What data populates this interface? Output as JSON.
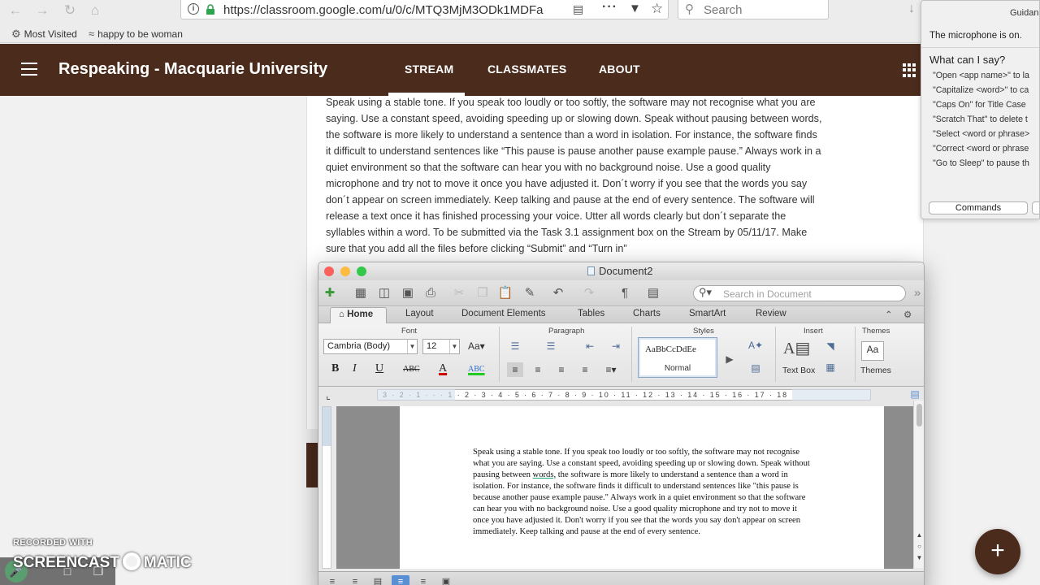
{
  "browser": {
    "url": "https://classroom.google.com/u/0/c/MTQ3MjM3ODk1MDFa",
    "search_placeholder": "Search",
    "bookmarks": [
      "Most Visited",
      "happy to be woman"
    ]
  },
  "classroom": {
    "title": "Respeaking - Macquarie University",
    "tabs": [
      "STREAM",
      "CLASSMATES",
      "ABOUT"
    ],
    "active_tab": "STREAM",
    "stream_text": "Speak using a stable tone. If you speak too loudly or too softly, the software may not recognise what you are saying. Use a constant speed, avoiding speeding up or slowing down. Speak without pausing between words, the software is more likely to understand a sentence than a word in isolation. For instance, the software finds it difficult to understand sentences like “This pause is pause another pause example pause.” Always work in a quiet environment so that the software can hear you with no background noise. Use a good quality microphone and try not to move it once you have adjusted it. Don´t worry if you see that the words you say don´t appear on screen immediately. Keep talking and pause at the end of every sentence. The software will release a text once it has finished processing your voice. Utter all words clearly but don´t separate the syllables within a word. To be submitted via the Task 3.1 assignment box on the Stream by 05/11/17. Make sure that you add all the files before clicking “Submit” and “Turn in”"
  },
  "word": {
    "doc_title": "Document2",
    "search_placeholder": "Search in Document",
    "tabs": [
      "Home",
      "Layout",
      "Document Elements",
      "Tables",
      "Charts",
      "SmartArt",
      "Review"
    ],
    "groups": {
      "font": "Font",
      "paragraph": "Paragraph",
      "styles": "Styles",
      "insert": "Insert",
      "themes": "Themes"
    },
    "font_name": "Cambria (Body)",
    "font_size": "12",
    "style_sample": "AaBbCcDdEe",
    "style_name": "Normal",
    "text_box_label": "Text Box",
    "themes_label": "Themes",
    "ruler_text": "3 · 2 · 1 · · · 1 · 2 · 3 · 4 · 5 · 6 · 7 · 8 · 9 · 10 · 11 · 12 · 13 · 14 · 15 · 16 · 17 · 18",
    "doc_text_before": "Speak using a stable tone. If you speak too loudly or too softly, the software may not recognise what you are saying. Use a constant speed, avoiding speeding up or slowing down. Speak without pausing between ",
    "doc_text_underlined": "words,",
    "doc_text_after": " the software is more likely to understand a sentence than a word in isolation. For instance, the software finds it difficult to understand sentences like \"this pause is because another pause example pause.\" Always work in a quiet environment so that the software can hear you with no background noise. Use a good quality microphone and try not to move it once you have adjusted it. Don't worry if you see that the words you say don't appear on screen immediately. Keep talking and pause at the end of every sentence."
  },
  "dictation": {
    "header": "Guidan",
    "mic_status": "The microphone is on.",
    "heading": "What can I say?",
    "commands": [
      "\"Open <app name>\" to la",
      "\"Capitalize <word>\" to ca",
      "\"Caps On\" for Title Case",
      "\"Scratch That\" to delete t",
      "\"Select <word or phrase>",
      "\"Correct <word or phrase",
      "\"Go to Sleep\" to pause th"
    ],
    "commands_button": "Commands"
  },
  "fab_label": "+",
  "watermark": {
    "recorded_with": "RECORDED WITH",
    "brand_left": "SCREENCAST",
    "brand_right": "MATIC"
  },
  "colors": {
    "classroom_header": "#4a2b1c",
    "traffic_red": "#fc605c",
    "traffic_yellow": "#fdbc40",
    "traffic_green": "#34c84a",
    "lock_green": "#2ea44f"
  }
}
